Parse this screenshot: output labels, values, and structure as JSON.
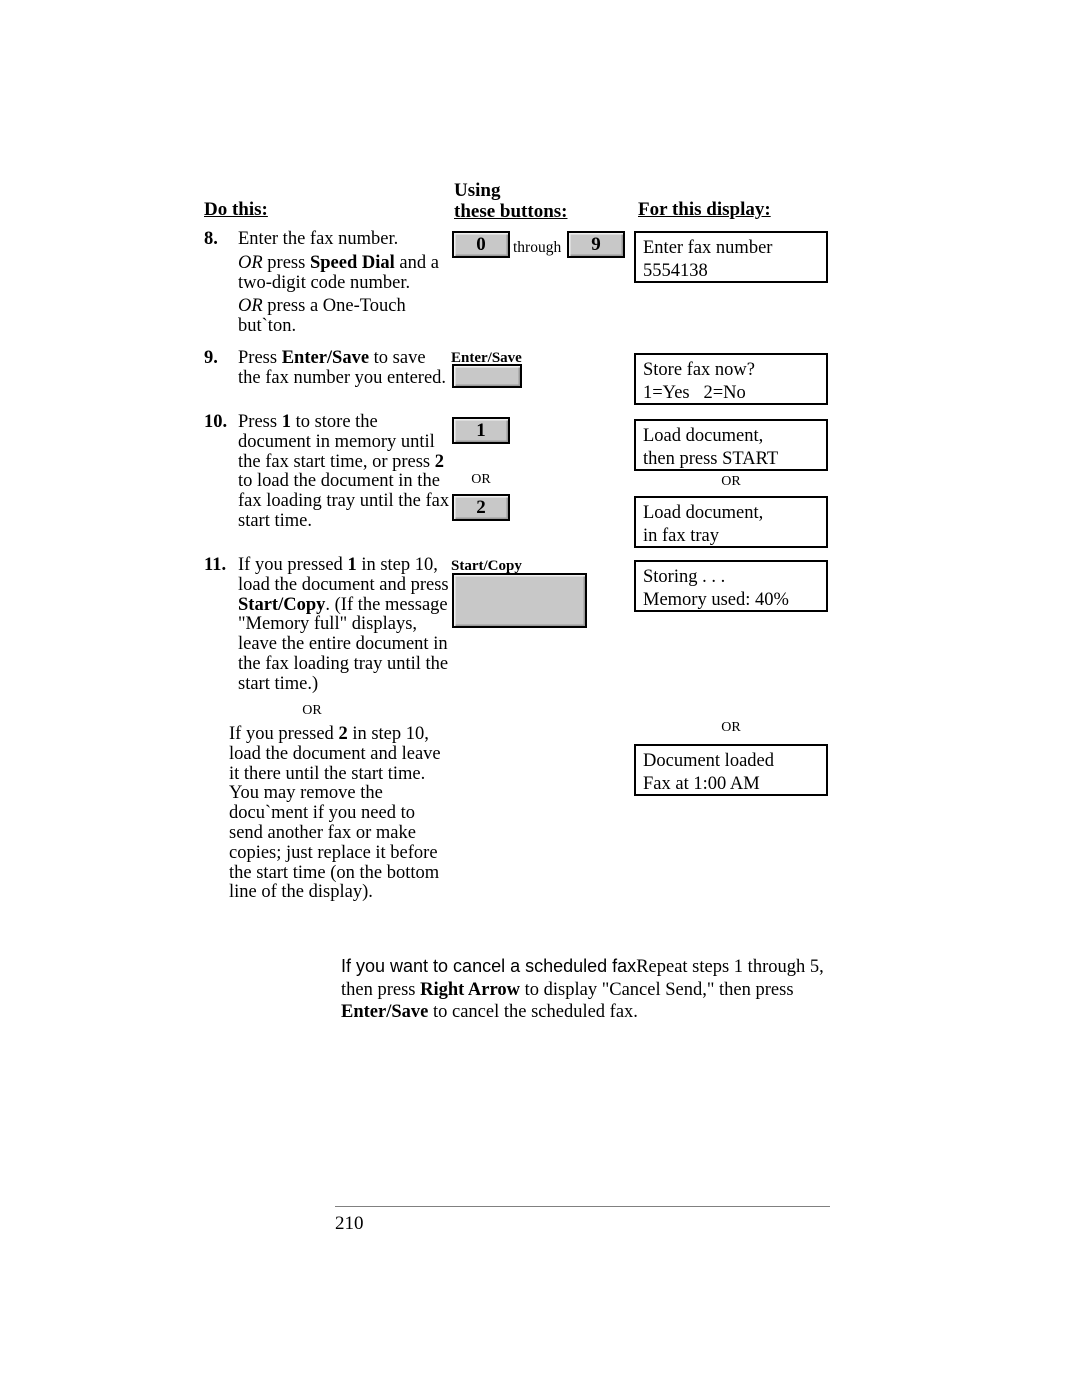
{
  "headers": {
    "do_this": "Do this:",
    "using": "Using",
    "these_buttons": "these buttons:",
    "for_this_display": "For this display:"
  },
  "steps": [
    {
      "number": "8.",
      "lines": [
        {
          "text": "Enter the fax number."
        },
        {
          "text": "OR press Speed Dial and a two-digit code number."
        },
        {
          "text": "OR press a One-Touch but`ton."
        }
      ]
    },
    {
      "number": "9.",
      "lines": [
        {
          "text": "Press Enter/Save to save the fax number you entered."
        }
      ]
    },
    {
      "number": "10.",
      "lines": [
        {
          "text": "Press 1 to store the document in memory until the fax start time, or press 2 to load the document in the fax loading tray until the fax start time."
        }
      ]
    },
    {
      "number": "11.",
      "lines": [
        {
          "text": "If you pressed 1 in step 10, load the document and press Start/Copy. (If the message \"Memory full\" displays, leave the entire document in the fax loading tray until the start time.)"
        }
      ]
    }
  ],
  "step11_alt": "If you pressed 2 in step 10, load the document and leave it there until the start time. You may remove the docu`ment if you need to send another fax or make copies; just replace it before the start time (on the bottom line of the display).",
  "or_labels": {
    "buttons_or": "OR",
    "display_or_1": "OR",
    "display_or_2": "OR",
    "left_or": "OR"
  },
  "buttons": [
    {
      "name": "key-0",
      "label": "0"
    },
    {
      "name": "key-9",
      "label": "9"
    },
    {
      "name": "key-1",
      "label": "1"
    },
    {
      "name": "key-2",
      "label": "2"
    },
    {
      "name": "enter-save",
      "caption": "Enter/Save",
      "label": ""
    },
    {
      "name": "start-copy",
      "caption": "Start/Copy",
      "label": ""
    }
  ],
  "through_label": "through",
  "displays": [
    {
      "line1": "Enter fax number",
      "line2": "5554138"
    },
    {
      "line1": "Store fax now?",
      "line2": "1=Yes   2=No"
    },
    {
      "line1": "Load document,",
      "line2": "then press START"
    },
    {
      "line1": "Load document,",
      "line2": "in fax tray"
    },
    {
      "line1": "Storing . . .",
      "line2": "Memory used: 40%"
    },
    {
      "line1": "Document loaded",
      "line2": "Fax at 1:00 AM"
    }
  ],
  "cancel_note": {
    "lead": "If you want to cancel a scheduled fax",
    "rest_1": "Repeat steps 1 through 5, then press ",
    "bold_1": "Right Arrow",
    "rest_2": " to display \"Cancel Send,\" then press ",
    "bold_2": "Enter/Save",
    "rest_3": " to cancel the scheduled fax."
  },
  "footer": {
    "page_number": "210"
  }
}
